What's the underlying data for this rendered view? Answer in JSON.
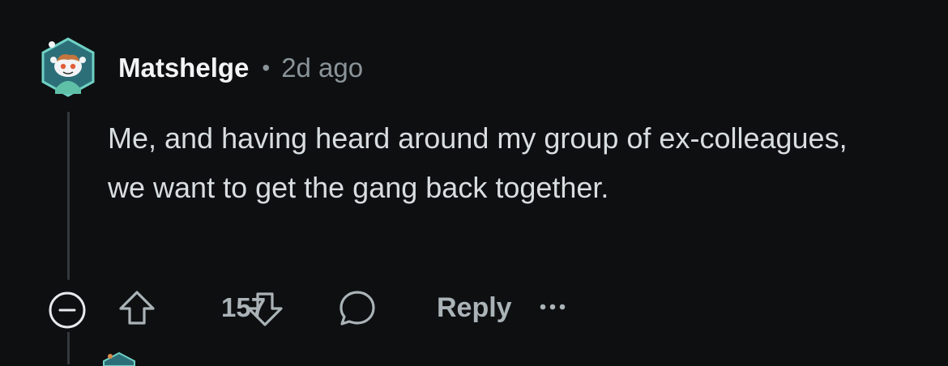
{
  "comment": {
    "author": "Matshelge",
    "separator": "•",
    "timestamp": "2d ago",
    "body": "Me, and having heard around my group of ex-colleagues, we want to get the gang back together.",
    "vote_count": "157",
    "reply_label": "Reply"
  },
  "icons": {
    "avatar": "snoo-avatar-icon",
    "collapse": "collapse-minus-icon",
    "upvote": "upvote-arrow-icon",
    "downvote": "downvote-arrow-icon",
    "reply": "speech-bubble-icon",
    "more": "more-options-icon"
  },
  "colors": {
    "background": "#0e0f11",
    "username": "#f2f4f5",
    "meta": "#8a9499",
    "body_text": "#d8dde0",
    "action": "#aab3b7",
    "avatar_hex": "#58c3b3"
  }
}
